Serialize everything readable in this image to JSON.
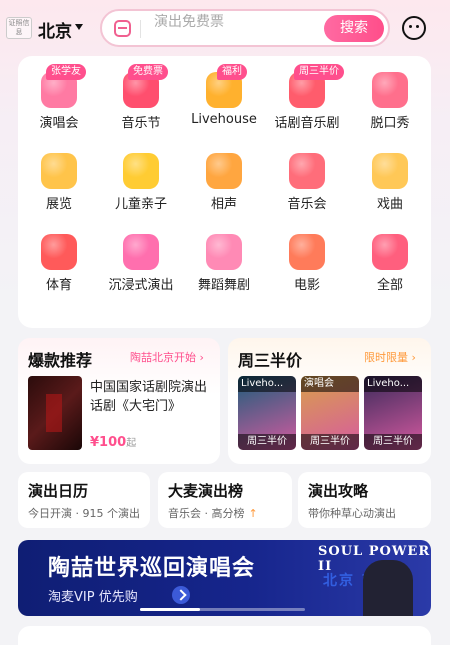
{
  "header": {
    "license_label": "证照信息",
    "city": "北京",
    "search_placeholder": "演出免费票",
    "search_button": "搜索",
    "icons": {
      "license": "license-icon",
      "caret": "chevron-down-icon",
      "scan": "scan-icon",
      "message": "message-icon"
    }
  },
  "categories": [
    {
      "label": "演唱会",
      "badge": "张学友",
      "icon": "microphone-icon",
      "color": "#ff7aa3"
    },
    {
      "label": "音乐节",
      "badge": "免费票",
      "icon": "music-note-icon",
      "color": "#ff4f6e"
    },
    {
      "label": "Livehouse",
      "badge": "福利",
      "icon": "guitar-icon",
      "color": "#ffb12e"
    },
    {
      "label": "话剧音乐剧",
      "badge": "周三半价",
      "icon": "theater-mask-icon",
      "color": "#ff5c6c"
    },
    {
      "label": "脱口秀",
      "badge": "",
      "icon": "lips-icon",
      "color": "#ff6f8c"
    },
    {
      "label": "展览",
      "badge": "",
      "icon": "picture-frame-icon",
      "color": "#ffc44a"
    },
    {
      "label": "儿童亲子",
      "badge": "",
      "icon": "duck-icon",
      "color": "#ffcc33"
    },
    {
      "label": "相声",
      "badge": "",
      "icon": "folding-fan-icon",
      "color": "#ffa640"
    },
    {
      "label": "音乐会",
      "badge": "",
      "icon": "piano-icon",
      "color": "#ff6d7a"
    },
    {
      "label": "戏曲",
      "badge": "",
      "icon": "opera-fan-icon",
      "color": "#ffc857"
    },
    {
      "label": "体育",
      "badge": "",
      "icon": "soccer-ball-icon",
      "color": "#ff5a5a"
    },
    {
      "label": "沉浸式演出",
      "badge": "",
      "icon": "vr-headset-icon",
      "color": "#ff6fae"
    },
    {
      "label": "舞蹈舞剧",
      "badge": "",
      "icon": "dancer-icon",
      "color": "#ff8ab5"
    },
    {
      "label": "电影",
      "badge": "",
      "icon": "clapperboard-icon",
      "color": "#ff7b5a"
    },
    {
      "label": "全部",
      "badge": "",
      "icon": "grid-icon",
      "color": "#ff5f7e"
    }
  ],
  "recommend": {
    "title": "爆款推荐",
    "tag": "陶喆北京开始",
    "show_title": "中国国家话剧院演出话剧《大宅门》",
    "price": "¥100",
    "price_unit": "起"
  },
  "half_price": {
    "title": "周三半价",
    "tag": "限时限量",
    "items": [
      {
        "top": "Liveho...",
        "bottom": "周三半价",
        "color": "#1b5e7a"
      },
      {
        "top": "演唱会",
        "bottom": "周三半价",
        "color": "#d9a04a"
      },
      {
        "top": "Liveho...",
        "bottom": "周三半价",
        "color": "#3a2a5a"
      }
    ]
  },
  "quick_cards": [
    {
      "title": "演出日历",
      "sub": "今日开演 · 915 个演出",
      "arrow": ""
    },
    {
      "title": "大麦演出榜",
      "sub": "音乐会 · 高分榜",
      "arrow": "↑"
    },
    {
      "title": "演出攻略",
      "sub": "带你种草心动演出",
      "arrow": ""
    }
  ],
  "banner": {
    "title": "陶喆世界巡回演唱会",
    "sub": "淘麦VIP 优先购",
    "right_title": "SOUL POWER II",
    "cities": "北京 南京"
  },
  "colors": {
    "accent": "#ff4f8d",
    "orange": "#ff9a3c",
    "banner": "#16258c"
  }
}
